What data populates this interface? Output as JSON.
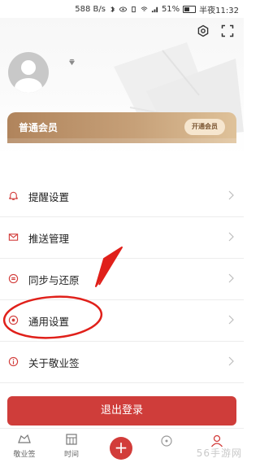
{
  "status_bar": {
    "net_speed": "588 B/s",
    "battery": "51%",
    "time": "半夜11:32"
  },
  "member": {
    "title": "普通会员",
    "open_button": "开通会员"
  },
  "menu": [
    {
      "label": "提醒设置",
      "icon": "bell-icon"
    },
    {
      "label": "推送管理",
      "icon": "mail-icon"
    },
    {
      "label": "同步与还原",
      "icon": "sync-icon"
    },
    {
      "label": "通用设置",
      "icon": "radio-dot-icon"
    },
    {
      "label": "关于敬业签",
      "icon": "info-icon"
    }
  ],
  "logout_label": "退出登录",
  "tabbar": {
    "tab1": "敬业签",
    "tab2": "时间"
  },
  "watermark": "56手游网",
  "colors": {
    "accent_red": "#cf3d3a",
    "gold": "#c6a078"
  }
}
